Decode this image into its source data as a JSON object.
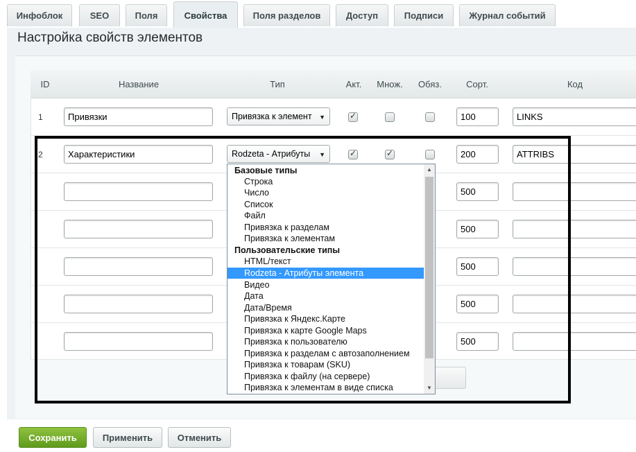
{
  "tabs": [
    "Инфоблок",
    "SEO",
    "Поля",
    "Свойства",
    "Поля разделов",
    "Доступ",
    "Подписи",
    "Журнал событий"
  ],
  "active_tab": "Свойства",
  "section_title": "Настройка свойств элементов",
  "columns": {
    "id": "ID",
    "name": "Название",
    "type": "Тип",
    "active": "Акт.",
    "multiple": "Множ.",
    "required": "Обяз.",
    "sort": "Сорт.",
    "code": "Код"
  },
  "rows": [
    {
      "id": "1",
      "name": "Привязки",
      "type": "Привязка к элемент",
      "active": true,
      "multiple": false,
      "required": false,
      "sort": "100",
      "code": "LINKS"
    },
    {
      "id": "2",
      "name": "Характеристики",
      "type": "Rodzeta - Атрибуты",
      "active": true,
      "multiple": true,
      "required": false,
      "sort": "200",
      "code": "ATTRIBS"
    },
    {
      "id": "",
      "name": "",
      "sort": "500",
      "code": ""
    },
    {
      "id": "",
      "name": "",
      "sort": "500",
      "code": ""
    },
    {
      "id": "",
      "name": "",
      "sort": "500",
      "code": ""
    },
    {
      "id": "",
      "name": "",
      "sort": "500",
      "code": ""
    },
    {
      "id": "",
      "name": "",
      "sort": "500",
      "code": ""
    }
  ],
  "dropdown": {
    "groups": [
      {
        "label": "Базовые типы",
        "options": [
          "Строка",
          "Число",
          "Список",
          "Файл",
          "Привязка к разделам",
          "Привязка к элементам"
        ]
      },
      {
        "label": "Пользовательские типы",
        "options": [
          "HTML/текст",
          "Rodzeta - Атрибуты элемента",
          "Видео",
          "Дата",
          "Дата/Время",
          "Привязка к Яндекс.Карте",
          "Привязка к карте Google Maps",
          "Привязка к пользователю",
          "Привязка к разделам с автозаполнением",
          "Привязка к товарам (SKU)",
          "Привязка к файлу (на сервере)",
          "Привязка к элементам в виде списка"
        ]
      }
    ],
    "selected": "Rodzeta - Атрибуты элемента"
  },
  "buttons": {
    "save": "Сохранить",
    "apply": "Применить",
    "cancel": "Отменить"
  },
  "colors": {
    "accent_green": "#6aa82a",
    "selection_blue": "#3399ff"
  }
}
